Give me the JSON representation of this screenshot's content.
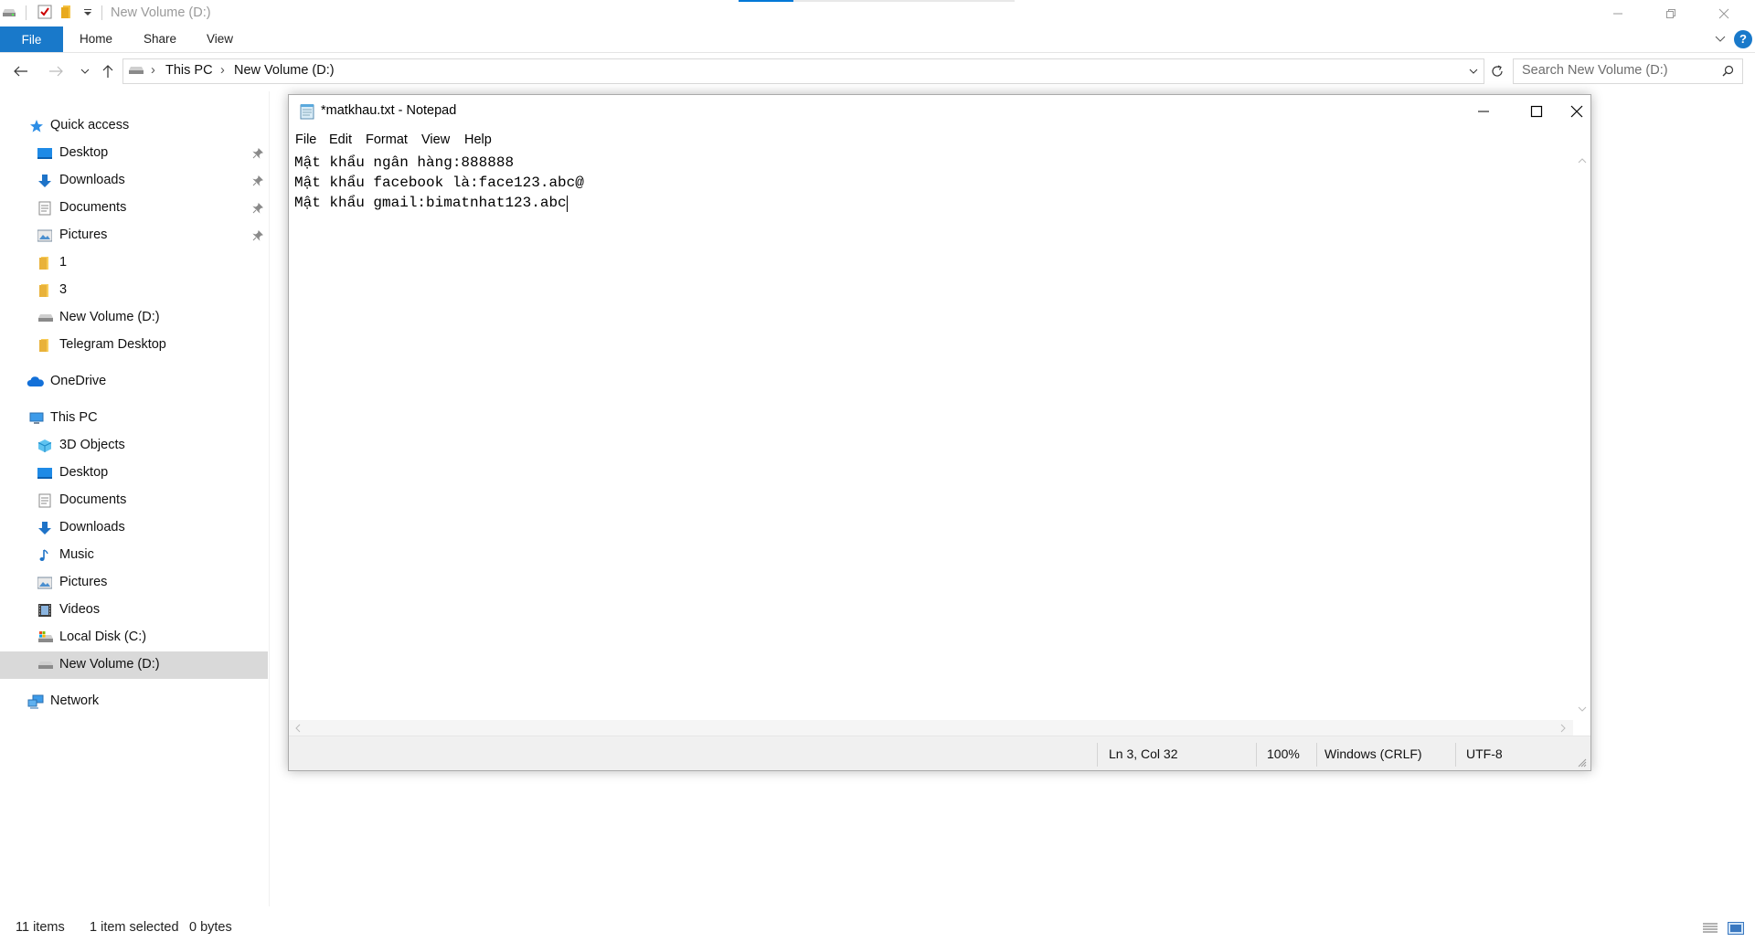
{
  "explorer": {
    "window_title": "New Volume (D:)",
    "ribbon": {
      "file": "File",
      "tabs": [
        "Home",
        "Share",
        "View"
      ],
      "help": "?"
    },
    "address": {
      "crumbs": [
        "This PC",
        "New Volume (D:)"
      ]
    },
    "search_placeholder": "Search New Volume (D:)",
    "nav": {
      "quick_access": "Quick access",
      "pinned": [
        "Desktop",
        "Downloads",
        "Documents",
        "Pictures"
      ],
      "recent": [
        "1",
        "3",
        "New Volume (D:)",
        "Telegram Desktop"
      ],
      "onedrive": "OneDrive",
      "this_pc": "This PC",
      "pc_items": [
        "3D Objects",
        "Desktop",
        "Documents",
        "Downloads",
        "Music",
        "Pictures",
        "Videos",
        "Local Disk (C:)",
        "New Volume (D:)"
      ],
      "network": "Network"
    },
    "status": {
      "items": "11 items",
      "selected": "1 item selected",
      "size": "0 bytes"
    }
  },
  "notepad": {
    "title": "*matkhau.txt - Notepad",
    "menu": [
      "File",
      "Edit",
      "Format",
      "View",
      "Help"
    ],
    "lines": [
      "Mật khẩu ngân hàng:888888",
      "Mật khẩu facebook là:face123.abc@",
      "Mật khẩu gmail:bimatnhat123.abc"
    ],
    "status": {
      "position": "Ln 3, Col 32",
      "zoom": "100%",
      "line_ending": "Windows (CRLF)",
      "encoding": "UTF-8"
    }
  },
  "colors": {
    "accent": "#1979ca",
    "selection": "#d9d9d9"
  }
}
